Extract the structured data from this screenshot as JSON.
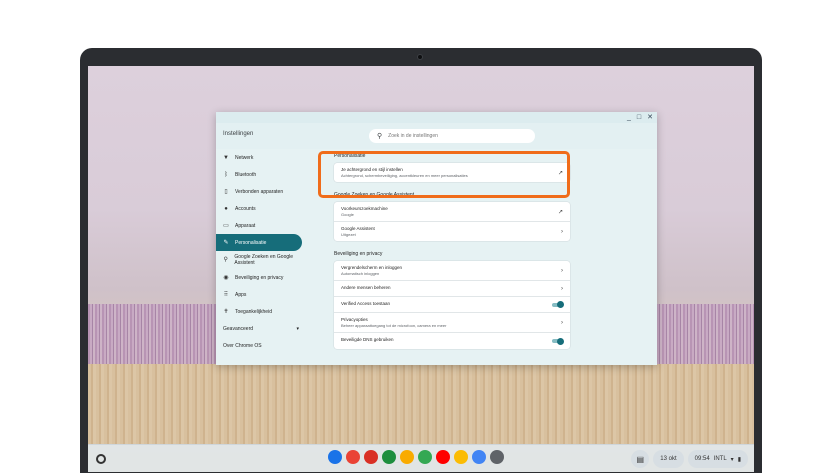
{
  "window": {
    "title": "Instellingen",
    "controls": [
      "_",
      "□",
      "✕"
    ],
    "search": {
      "placeholder": "Zoek in de instellingen"
    }
  },
  "sidebar": {
    "items": [
      {
        "label": "Netwerk",
        "icon": "wifi-icon"
      },
      {
        "label": "Bluetooth",
        "icon": "bluetooth-icon"
      },
      {
        "label": "Verbonden apparaten",
        "icon": "phone-icon"
      },
      {
        "label": "Accounts",
        "icon": "person-icon"
      },
      {
        "label": "Apparaat",
        "icon": "laptop-icon"
      },
      {
        "label": "Personalisatie",
        "icon": "brush-icon",
        "active": true
      },
      {
        "label": "Google Zoeken en Google Assistent",
        "icon": "search-icon"
      },
      {
        "label": "Beveiliging en privacy",
        "icon": "shield-icon"
      },
      {
        "label": "Apps",
        "icon": "grid-icon"
      },
      {
        "label": "Toegankelijkheid",
        "icon": "accessibility-icon"
      }
    ],
    "advanced": "Geavanceerd",
    "about": "Over Chrome OS"
  },
  "main": {
    "sections": [
      {
        "title": "Personalisatie",
        "rows": [
          {
            "title": "Je achtergrond en stijl instellen",
            "subtitle": "Achtergrond, schermbeveiliging, accentkleuren en meer personalisaties",
            "action": "↗"
          }
        ]
      },
      {
        "title": "Google Zoeken en Google Assistent",
        "rows": [
          {
            "title": "Voorkeurszoekmachine",
            "subtitle": "Google",
            "action": "↗"
          },
          {
            "title": "Google Assistent",
            "subtitle": "Uitgezet",
            "action": "›"
          }
        ]
      },
      {
        "title": "Beveiliging en privacy",
        "rows": [
          {
            "title": "Vergrendelscherm en inloggen",
            "subtitle": "Automatisch inloggen",
            "action": "›"
          },
          {
            "title": "Andere mensen beheren",
            "subtitle": "",
            "action": "›"
          },
          {
            "title": "Verified Access toestaan",
            "subtitle": "",
            "toggle": true
          },
          {
            "title": "Privacyopties",
            "subtitle": "Beheer apparaattoegang tot de microfoon, camera en meer",
            "action": "›"
          },
          {
            "title": "Beveiligde DNS gebruiken",
            "subtitle": "",
            "toggle": true
          }
        ]
      }
    ]
  },
  "shelf": {
    "apps": [
      {
        "name": "files-app",
        "color": "#1a73e8"
      },
      {
        "name": "chrome-app",
        "color": "#ea4335"
      },
      {
        "name": "gmail-app",
        "color": "#d93025"
      },
      {
        "name": "chat-app",
        "color": "#1e8e3e"
      },
      {
        "name": "photos-app",
        "color": "#f9ab00"
      },
      {
        "name": "play-app",
        "color": "#34a853"
      },
      {
        "name": "youtube-app",
        "color": "#ff0000"
      },
      {
        "name": "pinwheel-app",
        "color": "#fbbc04"
      },
      {
        "name": "docs-app",
        "color": "#4285f4"
      },
      {
        "name": "settings-app",
        "color": "#5f6368"
      }
    ],
    "date": "13 okt",
    "time": "09:54",
    "ime": "INTL"
  },
  "colors": {
    "accent": "#166d7a",
    "highlight": "#f06c1a"
  }
}
